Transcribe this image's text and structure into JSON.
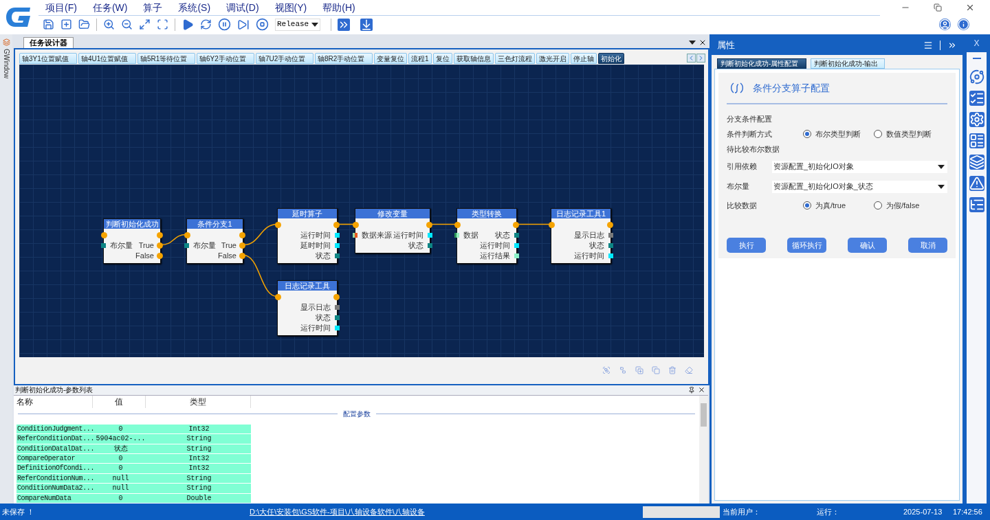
{
  "menu": [
    "项目(F)",
    "任务(W)",
    "算子",
    "系统(S)",
    "调试(D)",
    "视图(Y)",
    "帮助(H)"
  ],
  "toolbar": {
    "mode": "Release"
  },
  "side_tab": "GWindow",
  "document_tab": "任务设计器",
  "flow_tabs": [
    {
      "label": "轴3Y1位置赋值",
      "selected": false
    },
    {
      "label": "轴4U1位置赋值",
      "selected": false
    },
    {
      "label": "轴5R1等待位置",
      "selected": false
    },
    {
      "label": "轴6Y2手动位置",
      "selected": false
    },
    {
      "label": "轴7U2手动位置",
      "selected": false
    },
    {
      "label": "轴8R2手动位置",
      "selected": false
    },
    {
      "label": "变量复位",
      "selected": false
    },
    {
      "label": "流程1",
      "selected": false
    },
    {
      "label": "复位",
      "selected": false
    },
    {
      "label": "获取轴信息",
      "selected": false
    },
    {
      "label": "三色灯流程",
      "selected": false
    },
    {
      "label": "激光开启",
      "selected": false
    },
    {
      "label": "停止轴",
      "selected": false
    },
    {
      "label": "初始化",
      "selected": true
    }
  ],
  "nodes": [
    {
      "title": "判断初始化成功",
      "rows": [
        {
          "left_port": {
            "kind": "bool"
          },
          "right_port": {
            "kind": "bool"
          }
        },
        {
          "left": "布尔量",
          "left_port": {
            "kind": "state"
          },
          "right": "True",
          "right_port": {
            "kind": "bool"
          }
        },
        {
          "right": "False",
          "right_port": {
            "kind": "bool"
          }
        }
      ]
    },
    {
      "title": "条件分支1",
      "rows": [
        {
          "left_port": {
            "kind": "bool"
          },
          "right_port": {
            "kind": "bool"
          }
        },
        {
          "left": "布尔量",
          "left_port": {
            "kind": "state"
          },
          "right": "True",
          "right_port": {
            "kind": "bool"
          }
        },
        {
          "right": "False",
          "right_port": {
            "kind": "bool"
          }
        }
      ]
    },
    {
      "title": "延时算子",
      "rows": [
        {
          "left_port": {
            "kind": "bool"
          },
          "right_port": {
            "kind": "bool"
          }
        },
        {
          "right": "运行时间",
          "right_port": {
            "kind": "time"
          }
        },
        {
          "right": "延时时间",
          "right_port": {
            "kind": "time"
          }
        },
        {
          "right": "状态",
          "right_port": {
            "kind": "state"
          }
        }
      ]
    },
    {
      "title": "修改变量",
      "rows": [
        {
          "left_port": {
            "kind": "bool"
          },
          "right_port": {
            "kind": "bool"
          }
        },
        {
          "left": "数据来源",
          "left_port": {
            "kind": "source"
          },
          "right": "运行时间",
          "right_port": {
            "kind": "time"
          }
        },
        {
          "right": "状态",
          "right_port": {
            "kind": "state"
          }
        }
      ]
    },
    {
      "title": "类型转换",
      "rows": [
        {
          "left_port": {
            "kind": "bool"
          },
          "right_port": {
            "kind": "bool"
          }
        },
        {
          "left": "数据",
          "left_port": {
            "kind": "data"
          },
          "right": "状态",
          "right_port": {
            "kind": "state"
          }
        },
        {
          "right": "运行时间",
          "right_port": {
            "kind": "time"
          }
        },
        {
          "right": "运行结果",
          "right_port": {
            "kind": "result"
          }
        }
      ]
    },
    {
      "title": "日志记录工具1",
      "rows": [
        {
          "left_port": {
            "kind": "bool"
          },
          "right_port": {
            "kind": "bool"
          }
        },
        {
          "right": "显示日志",
          "right_port": {
            "kind": "log"
          }
        },
        {
          "right": "状态",
          "right_port": {
            "kind": "state"
          }
        },
        {
          "right": "运行时间",
          "right_port": {
            "kind": "time"
          }
        }
      ]
    },
    {
      "title": "日志记录工具",
      "rows": [
        {
          "left_port": {
            "kind": "bool"
          },
          "right_port": {
            "kind": "bool"
          }
        },
        {
          "right": "显示日志",
          "right_port": {
            "kind": "log"
          }
        },
        {
          "right": "状态",
          "right_port": {
            "kind": "state"
          }
        },
        {
          "right": "运行时间",
          "right_port": {
            "kind": "time"
          }
        }
      ]
    }
  ],
  "params": {
    "title": "判断初始化成功-参数列表",
    "columns": [
      "名称",
      "值",
      "类型"
    ],
    "group": "配置参数",
    "rows": [
      [
        "ConditionJudgment...",
        "0",
        "Int32"
      ],
      [
        "ReferConditionDat...",
        "5904ac02-...",
        "String"
      ],
      [
        "ConditionDatalDat...",
        "状态",
        "String"
      ],
      [
        "CompareOperator",
        "0",
        "Int32"
      ],
      [
        "DefinitionOfCondi...",
        "0",
        "Int32"
      ],
      [
        "ReferConditionNum...",
        "null",
        "String"
      ],
      [
        "ConditionNumData2...",
        "null",
        "String"
      ],
      [
        "CompareNumData",
        "0",
        "Double"
      ]
    ]
  },
  "properties": {
    "title": "属性",
    "tabs": [
      {
        "label": "判断初始化成功-属性配置",
        "selected": true
      },
      {
        "label": "判断初始化成功-输出",
        "selected": false
      }
    ],
    "heading": "条件分支算子配置",
    "section": "分支条件配置",
    "judge_mode": {
      "label": "条件判断方式",
      "options": [
        {
          "label": "布尔类型判断",
          "selected": true
        },
        {
          "label": "数值类型判断",
          "selected": false
        }
      ]
    },
    "sub_section": "待比较布尔数据",
    "selects": [
      {
        "label": "引用依赖",
        "value": "资源配置_初始化IO对象"
      },
      {
        "label": "布尔量",
        "value": "资源配置_初始化IO对象_状态"
      }
    ],
    "compare": {
      "label": "比较数据",
      "options": [
        {
          "label": "为真/true",
          "selected": true
        },
        {
          "label": "为假/false",
          "selected": false
        }
      ]
    },
    "buttons": [
      "执行",
      "循环执行",
      "确认",
      "取消"
    ]
  },
  "right_strip": {
    "close": "X"
  },
  "status_bar": {
    "save_state": "未保存 ！",
    "path": "D:\\大任\\安装包\\GS软件-项目\\八轴设备软件\\八轴设备",
    "user_label": "当前用户：",
    "run_label": "运行：",
    "date": "2025-07-13",
    "time": "17:42:56"
  }
}
